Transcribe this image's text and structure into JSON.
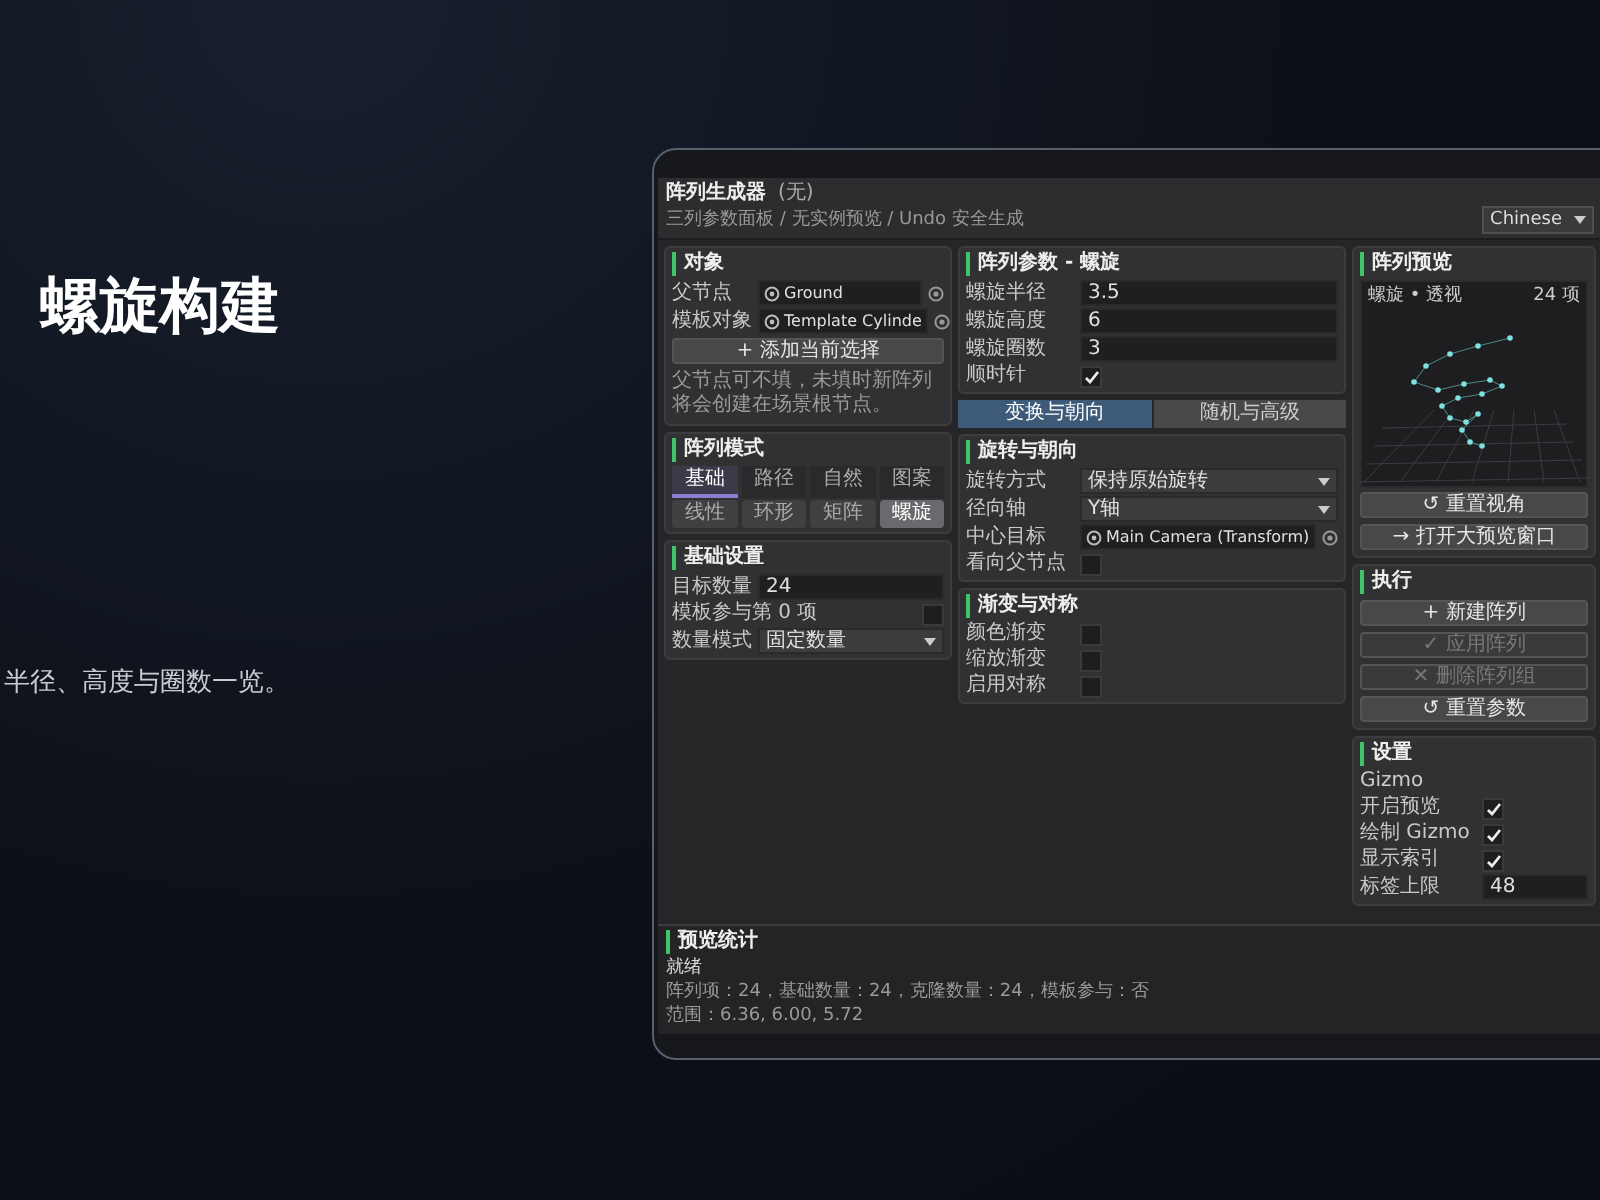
{
  "slide": {
    "title": "螺旋构建",
    "subtitle": "半径、高度与圈数一览。"
  },
  "window": {
    "title": "阵列生成器",
    "title_note": "(无)",
    "subtitle": "三列参数面板 / 无实例预览 / Undo 安全生成",
    "language": "Chinese"
  },
  "columns": [
    {
      "blocks": [
        {
          "kind": "panel",
          "title": "对象",
          "items": [
            {
              "kind": "object",
              "label": "父节点",
              "value": "Ground"
            },
            {
              "kind": "object",
              "label": "模板对象",
              "value": "Template Cylinde"
            },
            {
              "kind": "button",
              "label": "+ 添加当前选择",
              "disabled": false
            },
            {
              "kind": "note",
              "text": "父节点可不填，未填时新阵列将会创建在场景根节点。"
            }
          ]
        },
        {
          "kind": "panel",
          "title": "阵列模式",
          "items": [
            {
              "kind": "tabs",
              "options": [
                {
                  "label": "基础",
                  "selected": true
                },
                {
                  "label": "路径",
                  "selected": false
                },
                {
                  "label": "自然",
                  "selected": false
                },
                {
                  "label": "图案",
                  "selected": false
                }
              ]
            },
            {
              "kind": "segments",
              "options": [
                {
                  "label": "线性",
                  "selected": false
                },
                {
                  "label": "环形",
                  "selected": false
                },
                {
                  "label": "矩阵",
                  "selected": false
                },
                {
                  "label": "螺旋",
                  "selected": true
                }
              ]
            }
          ]
        },
        {
          "kind": "panel",
          "title": "基础设置",
          "items": [
            {
              "kind": "field",
              "label": "目标数量",
              "value": "24"
            },
            {
              "kind": "checkbox",
              "label": "模板参与第 0 项",
              "checked": false
            },
            {
              "kind": "dropdown",
              "label": "数量模式",
              "value": "固定数量"
            }
          ]
        }
      ]
    },
    {
      "blocks": [
        {
          "kind": "panel",
          "title": "阵列参数 - 螺旋",
          "items": [
            {
              "kind": "field",
              "label": "螺旋半径",
              "value": "3.5"
            },
            {
              "kind": "field",
              "label": "螺旋高度",
              "value": "6"
            },
            {
              "kind": "field",
              "label": "螺旋圈数",
              "value": "3"
            },
            {
              "kind": "checkbox",
              "label": "顺时针",
              "checked": true
            }
          ]
        },
        {
          "kind": "tabs",
          "options": [
            {
              "label": "变换与朝向",
              "selected": true
            },
            {
              "label": "随机与高级",
              "selected": false
            }
          ]
        },
        {
          "kind": "panel",
          "title": "旋转与朝向",
          "items": [
            {
              "kind": "dropdown",
              "label": "旋转方式",
              "value": "保持原始旋转"
            },
            {
              "kind": "dropdown",
              "label": "径向轴",
              "value": "Y轴"
            },
            {
              "kind": "object",
              "label": "中心目标",
              "value": "Main Camera (Transform)"
            },
            {
              "kind": "checkbox",
              "label": "看向父节点",
              "checked": false
            }
          ]
        },
        {
          "kind": "panel",
          "title": "渐变与对称",
          "items": [
            {
              "kind": "checkbox",
              "label": "颜色渐变",
              "checked": false
            },
            {
              "kind": "checkbox",
              "label": "缩放渐变",
              "checked": false
            },
            {
              "kind": "checkbox",
              "label": "启用对称",
              "checked": false
            }
          ]
        }
      ]
    },
    {
      "blocks": [
        {
          "kind": "panel",
          "title": "阵列预览",
          "items": [
            {
              "kind": "preview",
              "mode": "螺旋 • 透视",
              "count": "24 项"
            },
            {
              "kind": "button",
              "label": "↺ 重置视角",
              "disabled": false
            },
            {
              "kind": "button",
              "label": "→ 打开大预览窗口",
              "disabled": false
            }
          ]
        },
        {
          "kind": "panel",
          "title": "执行",
          "items": [
            {
              "kind": "button",
              "label": "+ 新建阵列",
              "disabled": false
            },
            {
              "kind": "button",
              "label": "✓ 应用阵列",
              "disabled": true
            },
            {
              "kind": "button",
              "label": "✕ 删除阵列组",
              "disabled": true
            },
            {
              "kind": "button",
              "label": "↺ 重置参数",
              "disabled": false
            }
          ]
        },
        {
          "kind": "panel",
          "title": "设置",
          "items": [
            {
              "kind": "heading",
              "text": "Gizmo"
            },
            {
              "kind": "checkbox",
              "label": "开启预览",
              "checked": true
            },
            {
              "kind": "checkbox",
              "label": "绘制 Gizmo",
              "checked": true
            },
            {
              "kind": "checkbox",
              "label": "显示索引",
              "checked": true
            },
            {
              "kind": "field",
              "label": "标签上限",
              "value": "48"
            }
          ]
        }
      ]
    }
  ],
  "stats": {
    "title": "预览统计",
    "lines": [
      "就绪",
      "阵列项：24，基础数量：24，克隆数量：24，模板参与：否",
      "范围：6.36, 6.00, 5.72"
    ]
  }
}
